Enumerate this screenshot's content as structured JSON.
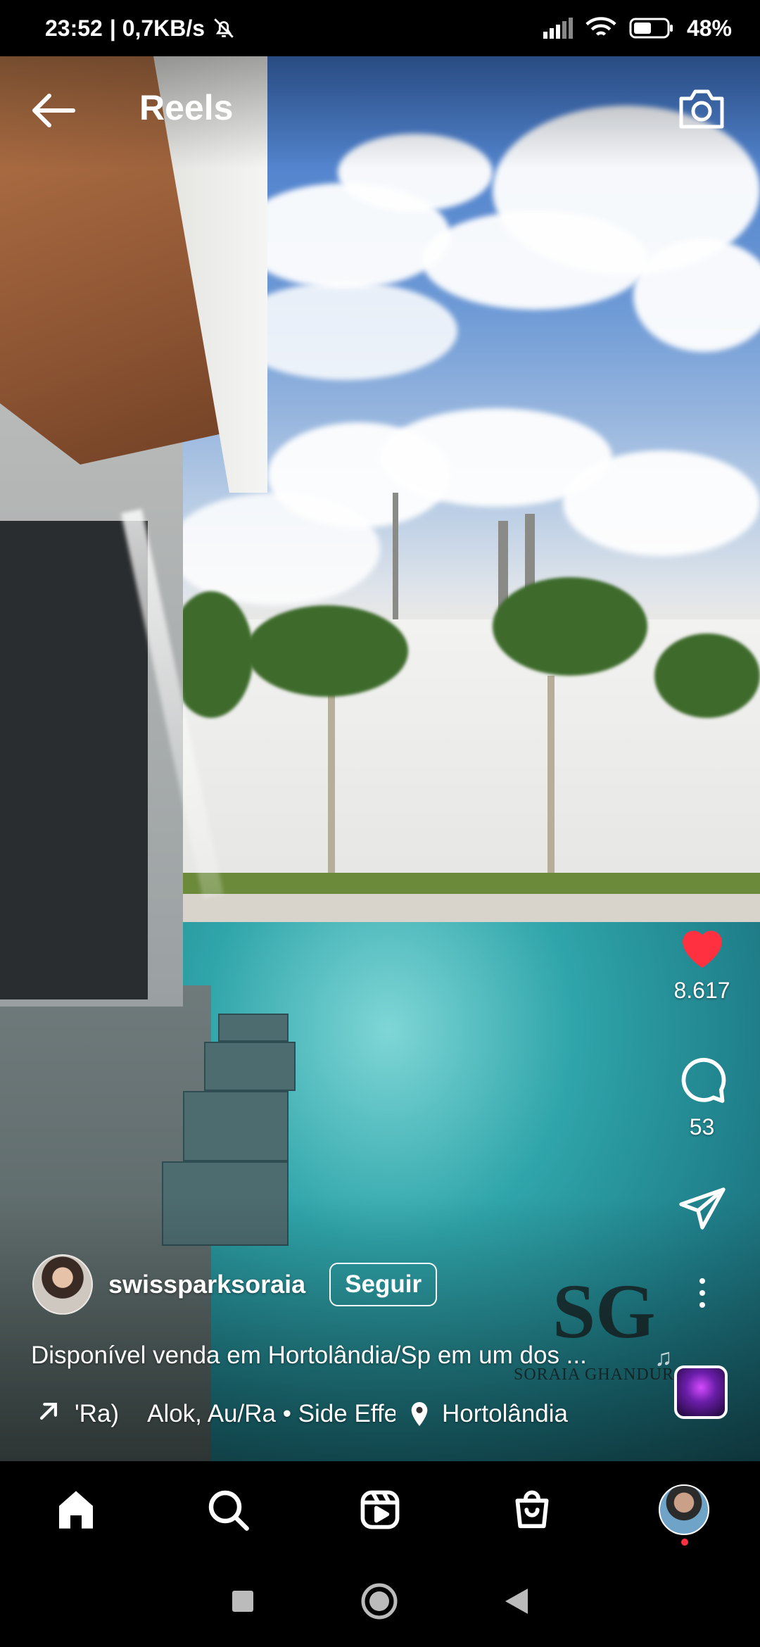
{
  "status_bar": {
    "time": "23:52",
    "network_speed": "| 0,7KB/s",
    "battery": "48%",
    "icons": [
      "mute-bell-icon",
      "signal-icon",
      "wifi-icon",
      "battery-icon"
    ]
  },
  "header": {
    "title": "Reels",
    "icons": [
      "back-arrow-icon",
      "camera-icon"
    ]
  },
  "actions": {
    "likes": "8.617",
    "comments": "53",
    "icons": [
      "heart-icon",
      "comment-icon",
      "share-icon",
      "more-icon"
    ],
    "heart_color": "#ff3040"
  },
  "author": {
    "username": "swissparksoraia",
    "follow_label": "Seguir"
  },
  "caption": "Disponível venda em Hortolândia/Sp em um dos ...",
  "music": {
    "part1": "'Ra)",
    "part2": "Alok, Au/Ra • Side Effe",
    "location": "Hortolândia"
  },
  "watermark": {
    "monogram": "SG",
    "name": "SORAIA GHANDUR"
  },
  "bottom_nav": {
    "items": [
      "home-icon",
      "search-icon",
      "reels-icon",
      "shop-icon",
      "profile-avatar"
    ]
  },
  "system_nav": {
    "items": [
      "recents-icon",
      "home-circle-icon",
      "back-triangle-icon"
    ]
  }
}
